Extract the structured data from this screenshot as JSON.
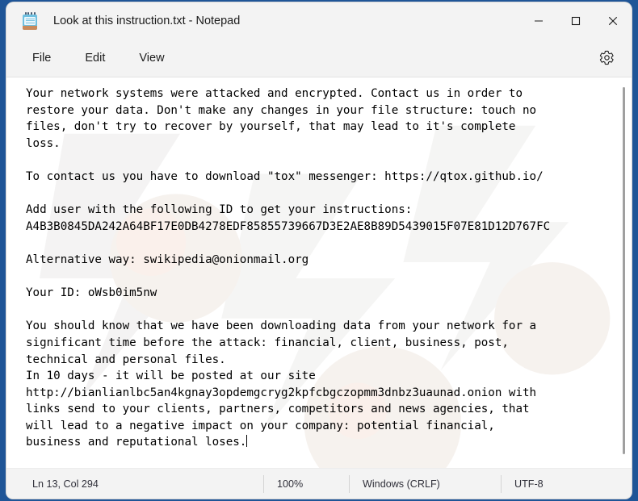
{
  "window": {
    "title": "Look at this instruction.txt - Notepad",
    "icon": "notepad-icon",
    "controls": {
      "minimize": "minimize-icon",
      "maximize": "maximize-icon",
      "close": "close-icon"
    }
  },
  "menubar": {
    "items": [
      {
        "label": "File"
      },
      {
        "label": "Edit"
      },
      {
        "label": "View"
      }
    ],
    "settings_icon": "gear-icon"
  },
  "editor": {
    "content": "Your network systems were attacked and encrypted. Contact us in order to\nrestore your data. Don't make any changes in your file structure: touch no\nfiles, don't try to recover by yourself, that may lead to it's complete\nloss.\n\nTo contact us you have to download \"tox\" messenger: https://qtox.github.io/\n\nAdd user with the following ID to get your instructions:\nA4B3B0845DA242A64BF17E0DB4278EDF85855739667D3E2AE8B89D5439015F07E81D12D767FC\n\nAlternative way: swikipedia@onionmail.org\n\nYour ID: oWsb0im5nw\n\nYou should know that we have been downloading data from your network for a\nsignificant time before the attack: financial, client, business, post,\ntechnical and personal files.\nIn 10 days - it will be posted at our site\nhttp://bianlianlbc5an4kgnay3opdemgcryg2kpfcbgczopmm3dnbz3uaunad.onion with\nlinks send to your clients, partners, competitors and news agencies, that\nwill lead to a negative impact on your company: potential financial,\nbusiness and reputational loses.",
    "tox_link": "https://qtox.github.io/",
    "tox_id": "A4B3B0845DA242A64BF17E0DB4278EDF85855739667D3E2AE8B89D5439015F07E81D12D767FC",
    "email": "swikipedia@onionmail.org",
    "victim_id": "oWsb0im5nw",
    "onion_url": "http://bianlianlbc5an4kgnay3opdemgcryg2kpfcbgczopmm3dnbz3uaunad.onion",
    "deadline_days": "10"
  },
  "statusbar": {
    "cursor_position": "Ln 13, Col 294",
    "zoom": "100%",
    "line_ending": "Windows (CRLF)",
    "encoding": "UTF-8"
  },
  "colors": {
    "desktop": "#1f5597",
    "chrome": "#f3f3f3",
    "editor_bg": "#ffffff",
    "text": "#000000"
  }
}
